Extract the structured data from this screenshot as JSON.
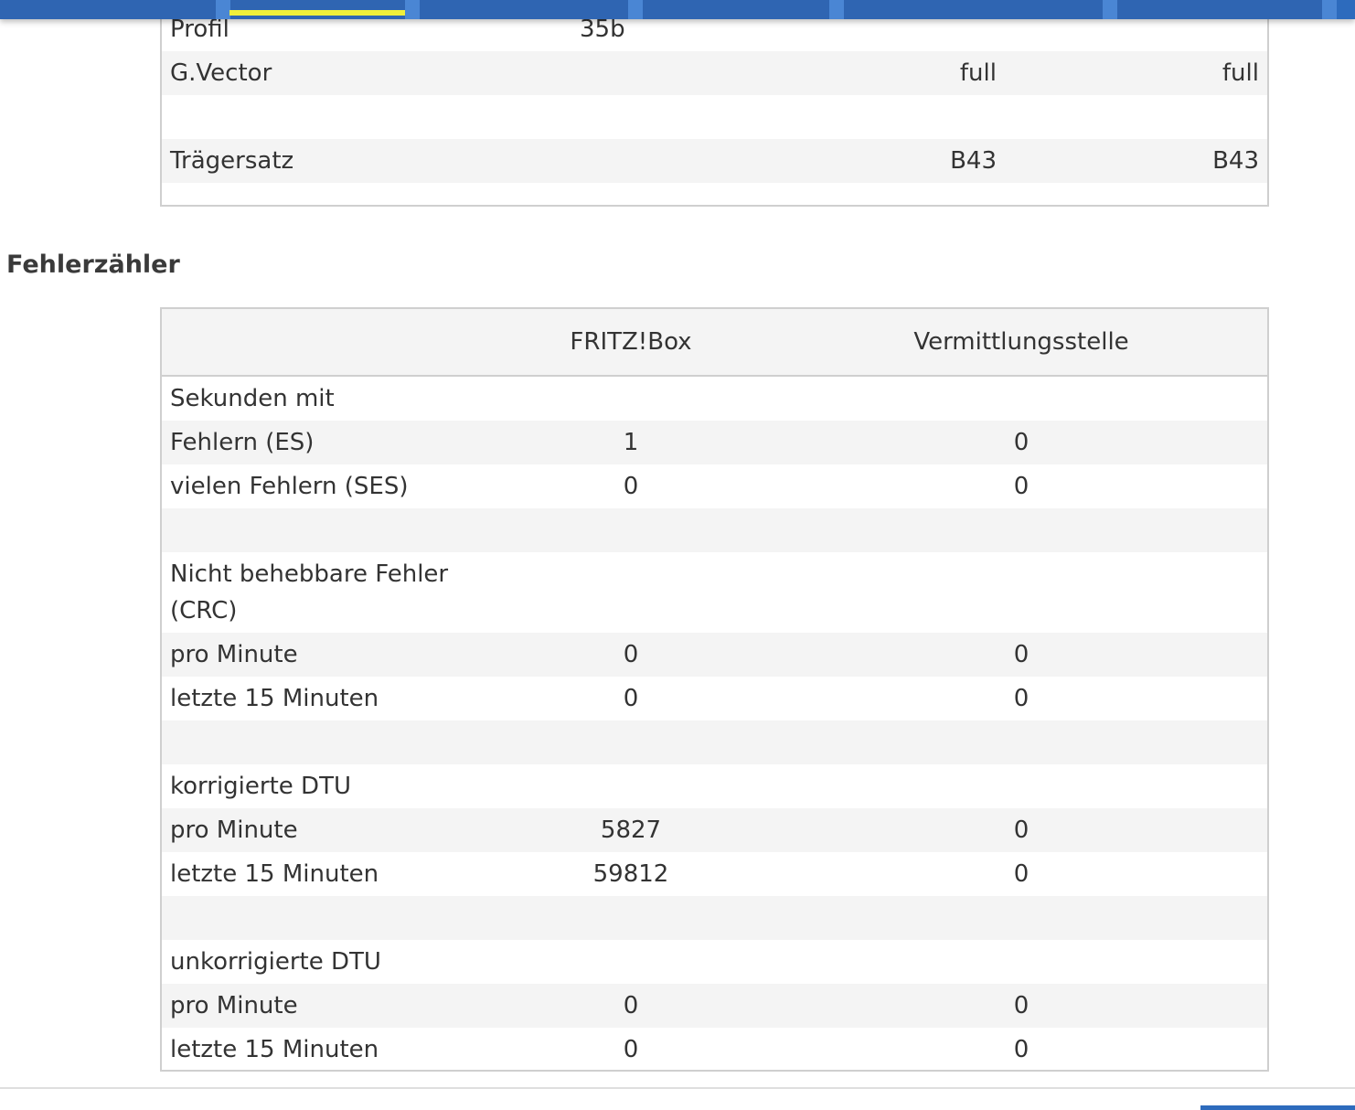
{
  "nav": {
    "active_indicator_color": "#f0ef3a",
    "bar_color": "#2d6bbd"
  },
  "line_settings": {
    "rows": [
      {
        "label": "Profil",
        "value": "35b",
        "fritzbox": "",
        "exchange": ""
      },
      {
        "label": "G.Vector",
        "value": "",
        "fritzbox": "full",
        "exchange": "full"
      },
      {
        "label": "",
        "value": "",
        "fritzbox": "",
        "exchange": ""
      },
      {
        "label": "Trägersatz",
        "value": "",
        "fritzbox": "B43",
        "exchange": "B43"
      }
    ]
  },
  "error_counter": {
    "title": "Fehlerzähler",
    "columns": {
      "fritzbox": "FRITZ!Box",
      "exchange": "Vermittlungsstelle"
    },
    "rows": [
      {
        "label": "Sekunden mit",
        "fritzbox": "",
        "exchange": ""
      },
      {
        "label": "Fehlern (ES)",
        "fritzbox": "1",
        "exchange": "0"
      },
      {
        "label": "vielen Fehlern (SES)",
        "fritzbox": "0",
        "exchange": "0"
      },
      {
        "label": "",
        "fritzbox": "",
        "exchange": ""
      },
      {
        "label": "Nicht behebbare Fehler (CRC)",
        "fritzbox": "",
        "exchange": ""
      },
      {
        "label": "pro Minute",
        "fritzbox": "0",
        "exchange": "0"
      },
      {
        "label": "letzte 15 Minuten",
        "fritzbox": "0",
        "exchange": "0"
      },
      {
        "label": "",
        "fritzbox": "",
        "exchange": ""
      },
      {
        "label": "korrigierte DTU",
        "fritzbox": "",
        "exchange": ""
      },
      {
        "label": "pro Minute",
        "fritzbox": "5827",
        "exchange": "0"
      },
      {
        "label": "letzte 15 Minuten",
        "fritzbox": "59812",
        "exchange": "0"
      },
      {
        "label": "",
        "fritzbox": "",
        "exchange": ""
      },
      {
        "label": "unkorrigierte DTU",
        "fritzbox": "",
        "exchange": ""
      },
      {
        "label": "pro Minute",
        "fritzbox": "0",
        "exchange": "0"
      },
      {
        "label": "letzte 15 Minuten",
        "fritzbox": "0",
        "exchange": "0"
      }
    ]
  }
}
